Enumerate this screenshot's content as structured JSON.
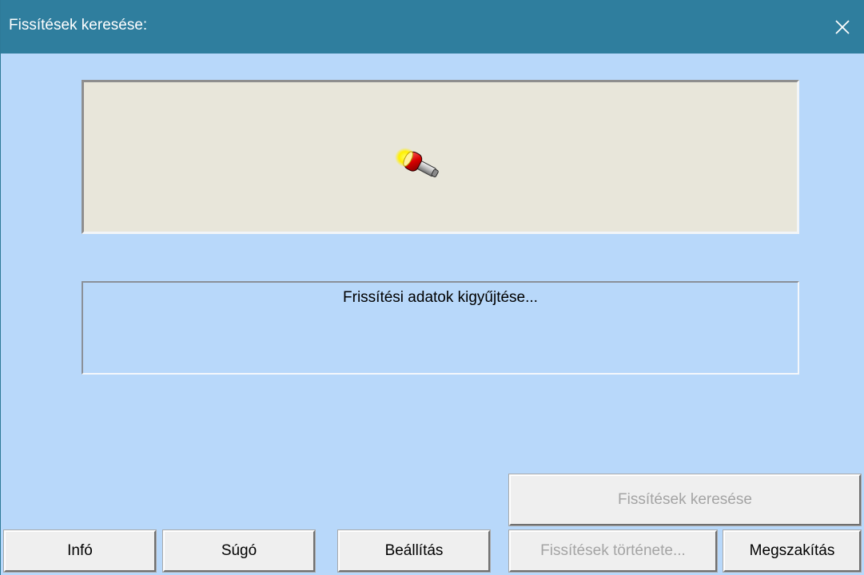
{
  "window": {
    "title": "Fissítések keresése:",
    "close_icon": "close-icon"
  },
  "animation": {
    "icon": "flashlight-icon"
  },
  "status": {
    "message": "Frissítési adatok kigyűjtése..."
  },
  "buttons": {
    "search": "Fissítések keresése",
    "info": "Infó",
    "help": "Súgó",
    "settings": "Beállítás",
    "history": "Fissítések története...",
    "cancel": "Megszakítás"
  },
  "colors": {
    "titlebar": "#2f7e9e",
    "window_bg": "#b8d8fa",
    "animation_bg": "#e8e6da",
    "disabled_text": "#a4a4a4"
  }
}
